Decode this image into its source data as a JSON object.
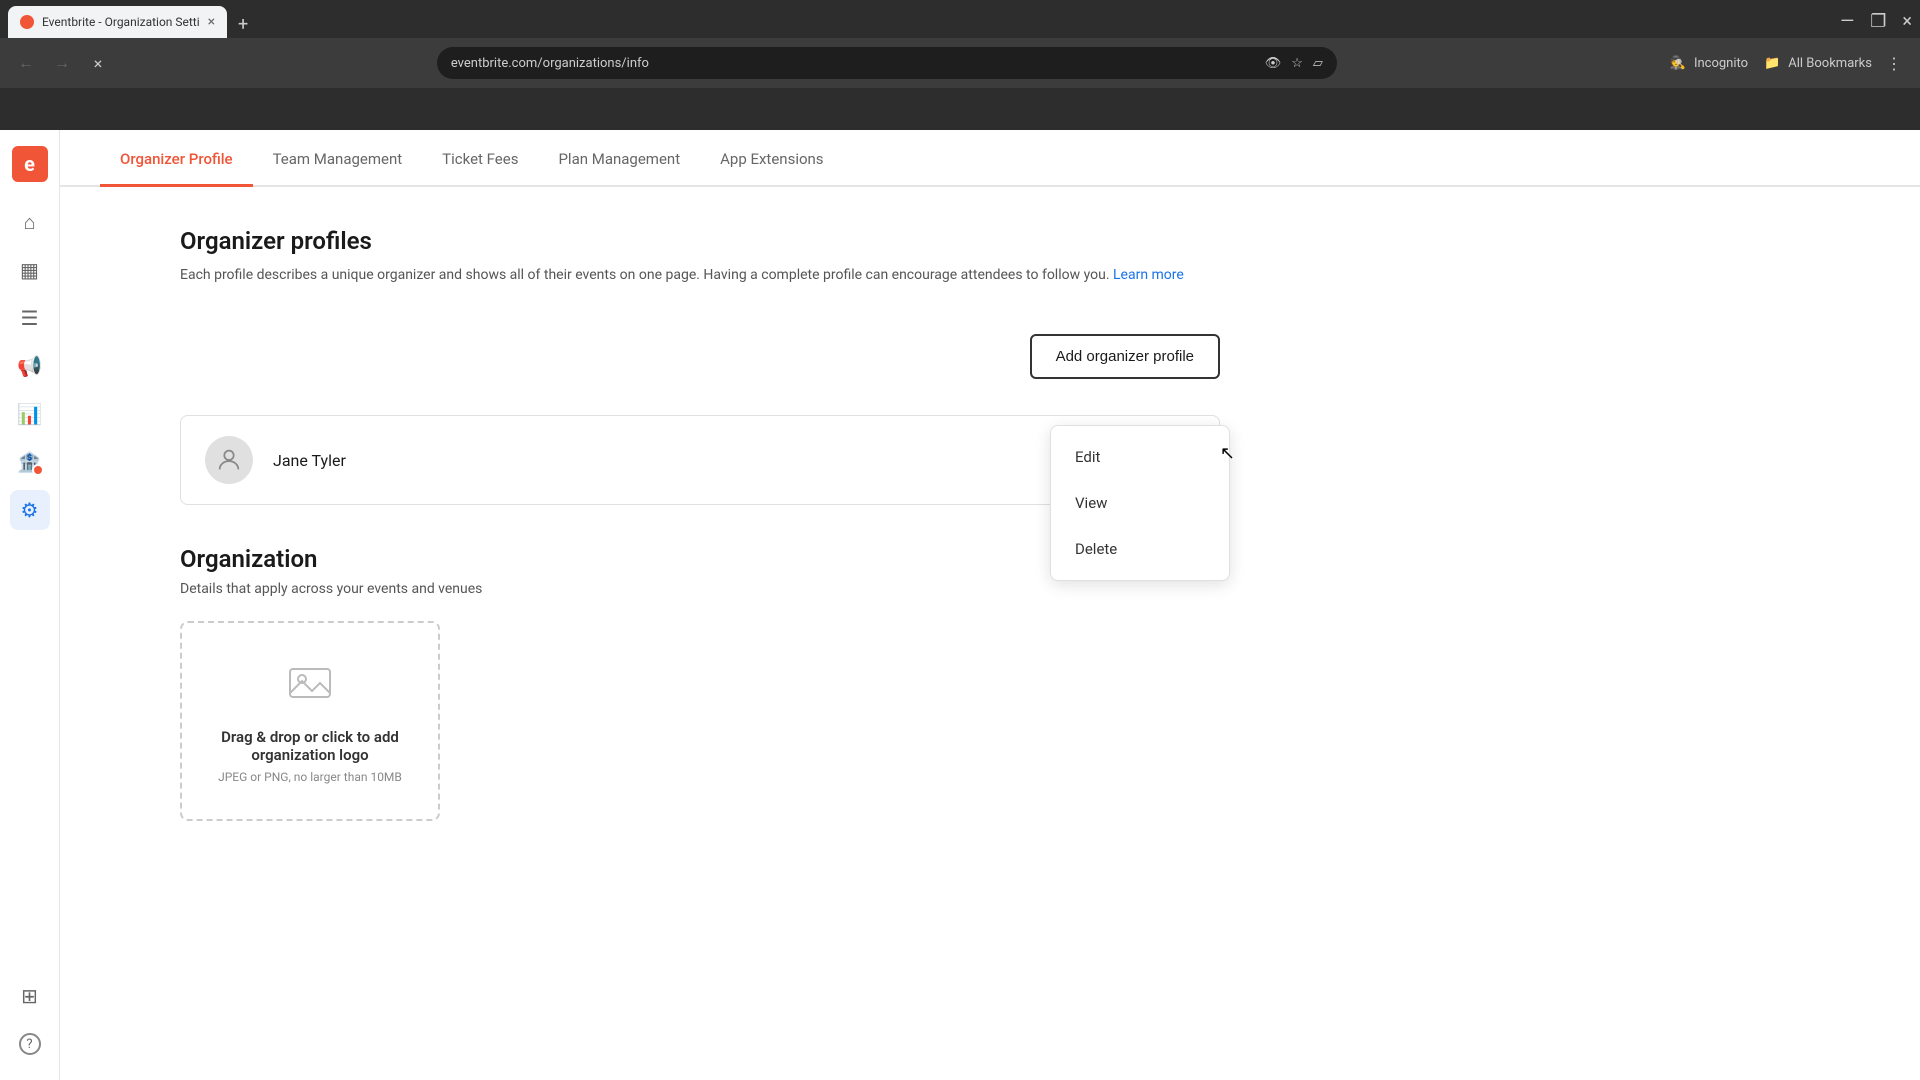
{
  "browser": {
    "url": "eventbrite.com/organizations/info",
    "tab_title": "Eventbrite - Organization Setti",
    "tab_close": "×",
    "new_tab": "+",
    "controls": {
      "minimize": "—",
      "maximize": "❐",
      "close": "×"
    },
    "nav": {
      "back": "←",
      "forward": "→",
      "reload": "×",
      "more": "⋮"
    },
    "incognito_label": "Incognito",
    "bookmarks_label": "All Bookmarks"
  },
  "sidebar": {
    "logo_text": "e",
    "items": [
      {
        "id": "home",
        "icon": "⌂",
        "label": "Home"
      },
      {
        "id": "calendar",
        "icon": "📅",
        "label": "Calendar"
      },
      {
        "id": "orders",
        "icon": "📋",
        "label": "Orders"
      },
      {
        "id": "marketing",
        "icon": "📢",
        "label": "Marketing"
      },
      {
        "id": "analytics",
        "icon": "📊",
        "label": "Analytics"
      },
      {
        "id": "finance",
        "icon": "🏦",
        "label": "Finance",
        "has_badge": true
      },
      {
        "id": "settings",
        "icon": "⚙",
        "label": "Settings",
        "active": true
      },
      {
        "id": "apps",
        "icon": "⊞",
        "label": "Apps"
      },
      {
        "id": "help",
        "icon": "?",
        "label": "Help"
      }
    ]
  },
  "nav_tabs": [
    {
      "id": "organizer-profile",
      "label": "Organizer Profile",
      "active": true
    },
    {
      "id": "team-management",
      "label": "Team Management",
      "active": false
    },
    {
      "id": "ticket-fees",
      "label": "Ticket Fees",
      "active": false
    },
    {
      "id": "plan-management",
      "label": "Plan Management",
      "active": false
    },
    {
      "id": "app-extensions",
      "label": "App Extensions",
      "active": false
    }
  ],
  "organizer_profiles": {
    "section_title": "Organizer profiles",
    "section_desc": "Each profile describes a unique organizer and shows all of their events on one page. Having a complete profile can encourage attendees to follow you.",
    "learn_more_label": "Learn more",
    "add_button_label": "Add organizer profile",
    "profiles": [
      {
        "name": "Jane Tyler"
      }
    ]
  },
  "context_menu": {
    "items": [
      {
        "id": "edit",
        "label": "Edit"
      },
      {
        "id": "view",
        "label": "View"
      },
      {
        "id": "delete",
        "label": "Delete"
      }
    ]
  },
  "organization": {
    "section_title": "Organization",
    "section_desc": "Details that apply across your events and venues",
    "logo_upload": {
      "title": "Drag & drop or click to add organization logo",
      "hint": "JPEG or PNG, no larger than 10MB"
    }
  }
}
